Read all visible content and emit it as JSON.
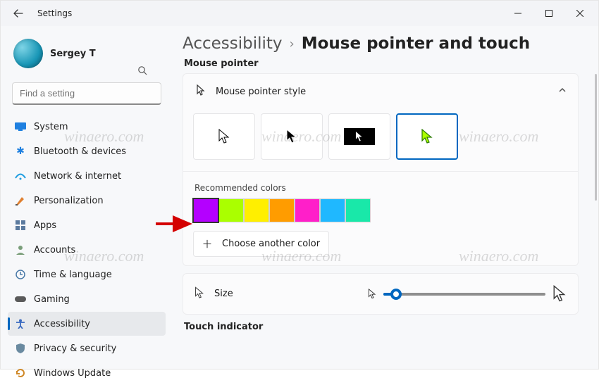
{
  "window": {
    "title": "Settings"
  },
  "user": {
    "name": "Sergey T"
  },
  "search": {
    "placeholder": "Find a setting"
  },
  "sidebar": {
    "items": [
      {
        "label": "System"
      },
      {
        "label": "Bluetooth & devices"
      },
      {
        "label": "Network & internet"
      },
      {
        "label": "Personalization"
      },
      {
        "label": "Apps"
      },
      {
        "label": "Accounts"
      },
      {
        "label": "Time & language"
      },
      {
        "label": "Gaming"
      },
      {
        "label": "Accessibility"
      },
      {
        "label": "Privacy & security"
      },
      {
        "label": "Windows Update"
      }
    ],
    "selected_index": 8
  },
  "breadcrumb": {
    "parent": "Accessibility",
    "current": "Mouse pointer and touch"
  },
  "sections": {
    "mouse_pointer_label": "Mouse pointer",
    "pointer_style_title": "Mouse pointer style",
    "recommended_colors_label": "Recommended colors",
    "choose_another_label": "Choose another color",
    "size_label": "Size",
    "touch_indicator_label": "Touch indicator"
  },
  "pointer_styles": {
    "selected_index": 3
  },
  "colors": {
    "swatches": [
      "#b400ff",
      "#aaff00",
      "#ffef00",
      "#ff9c00",
      "#ff1fc9",
      "#1fb8ff",
      "#19e8a9"
    ],
    "selected_index": 0
  },
  "size_slider": {
    "value_percent": 8
  },
  "watermark_text": "winaero.com"
}
